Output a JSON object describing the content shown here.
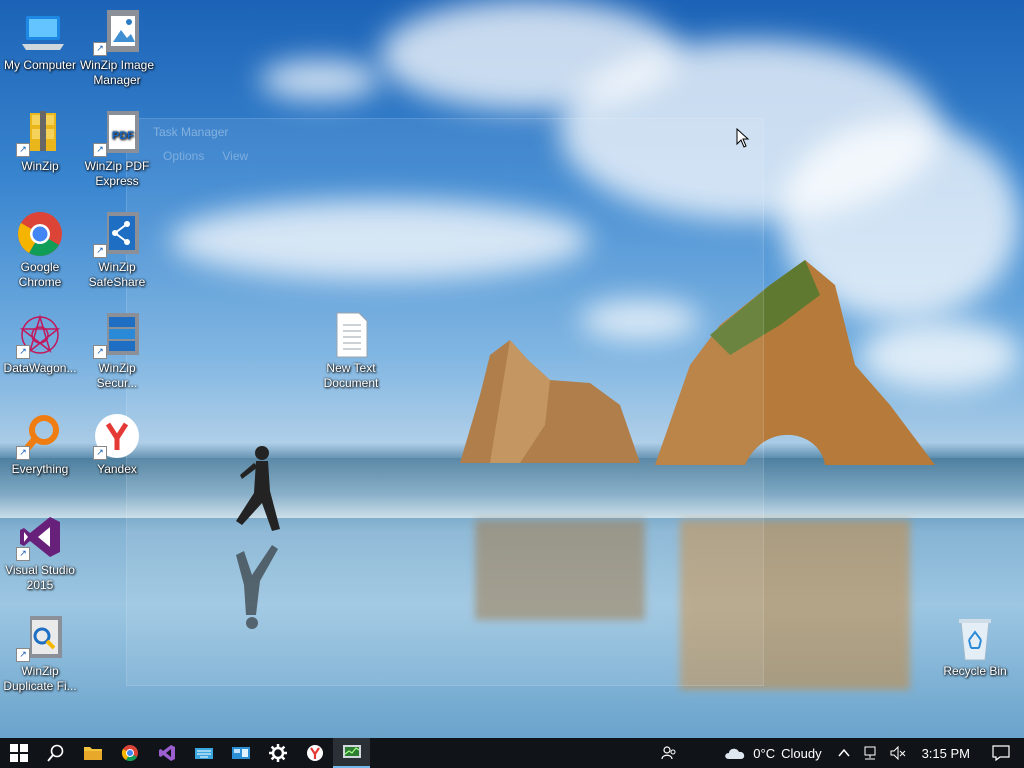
{
  "ghost_window": {
    "title": "Task Manager",
    "menu": [
      "Options",
      "View"
    ]
  },
  "desktop_icons": [
    {
      "label": "My Computer",
      "icon": "computer-icon"
    },
    {
      "label": "WinZip Image Manager",
      "icon": "winzip-image-manager-icon"
    },
    {
      "label": "WinZip",
      "icon": "winzip-icon"
    },
    {
      "label": "WinZip PDF Express",
      "icon": "winzip-pdf-express-icon"
    },
    {
      "label": "Google Chrome",
      "icon": "chrome-icon"
    },
    {
      "label": "WinZip SafeShare",
      "icon": "winzip-safeshare-icon"
    },
    {
      "label": "DataWagon...",
      "icon": "datawagon-icon"
    },
    {
      "label": "WinZip Secur...",
      "icon": "winzip-secure-icon"
    },
    {
      "label": "New Text Document",
      "icon": "text-document-icon"
    },
    {
      "label": "Everything",
      "icon": "everything-search-icon"
    },
    {
      "label": "Yandex",
      "icon": "yandex-icon"
    },
    {
      "label": "Visual Studio 2015",
      "icon": "visual-studio-icon"
    },
    {
      "label": "WinZip Duplicate Fi...",
      "icon": "winzip-duplicate-finder-icon"
    },
    {
      "label": "Recycle Bin",
      "icon": "recycle-bin-icon"
    }
  ],
  "taskbar": {
    "buttons": [
      "start-icon",
      "search-icon",
      "file-explorer-icon",
      "chrome-icon",
      "visual-studio-icon",
      "keyboard-icon",
      "control-panel-icon",
      "settings-icon",
      "yandex-icon",
      "task-manager-icon"
    ],
    "weather": {
      "temp": "0°C",
      "condition": "Cloudy"
    },
    "time": "3:15 PM"
  }
}
